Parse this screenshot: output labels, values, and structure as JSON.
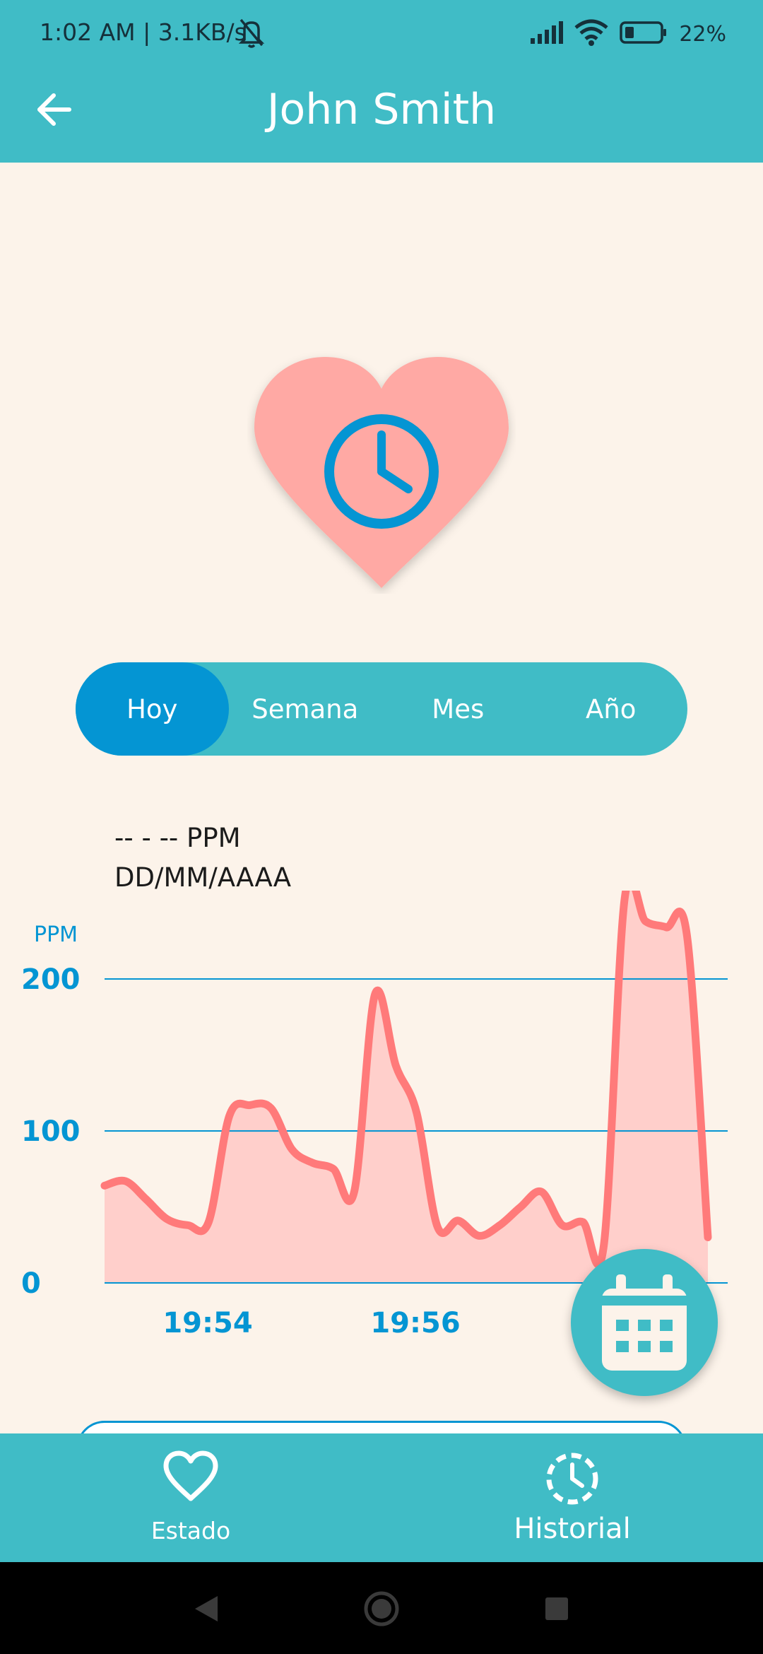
{
  "status_bar": {
    "time": "1:02 AM | 3.1KB/s",
    "battery_percent": "22%",
    "icons": [
      "bell-off-icon",
      "signal-icon",
      "wifi-icon",
      "battery-icon"
    ]
  },
  "app_bar": {
    "title": "John Smith",
    "back_icon": "arrow-left-icon"
  },
  "hero": {
    "icon": "heart-clock-icon",
    "heart_color": "#ffa9a4",
    "clock_color": "#0495d3"
  },
  "tabs": [
    {
      "label": "Hoy",
      "active": true
    },
    {
      "label": "Semana",
      "active": false
    },
    {
      "label": "Mes",
      "active": false
    },
    {
      "label": "Año",
      "active": false
    }
  ],
  "reading": {
    "value": "-- - -- PPM",
    "date": "DD/MM/AAAA"
  },
  "chart_data": {
    "type": "area",
    "ylabel": "PPM",
    "ylim": [
      0,
      200
    ],
    "yticks": [
      "200",
      "100",
      "0"
    ],
    "xticks": [
      "19:54",
      "19:56"
    ],
    "values": [
      64,
      67,
      55,
      42,
      38,
      40,
      110,
      117,
      115,
      88,
      79,
      75,
      60,
      190,
      143,
      112,
      37,
      41,
      31,
      38,
      50,
      60,
      38,
      40,
      25,
      253,
      238,
      234,
      228,
      30
    ],
    "line_color": "#ff7a7a",
    "fill_color": "#ffcfcb",
    "grid_color": "#0495d3"
  },
  "fab": {
    "icon": "calendar-icon"
  },
  "bottom_nav": [
    {
      "label": "Estado",
      "icon": "heart-outline-icon"
    },
    {
      "label": "Historial",
      "icon": "history-clock-icon"
    }
  ],
  "colors": {
    "primary": "#40bcc6",
    "accent": "#0495d3",
    "background": "#fcf3ea"
  }
}
